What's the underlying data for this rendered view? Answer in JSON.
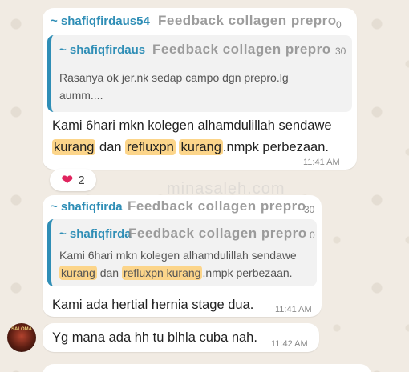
{
  "colors": {
    "accent": "#2f8eb6",
    "highlight": "#fcd58a",
    "heart": "#e0245e",
    "wallpaper": "#f1ebe3"
  },
  "overlay_title": "Feedback collagen prepro",
  "watermark": "minasaleh.com",
  "messages": [
    {
      "header_sender": "~ shafiqfirdaus54",
      "header_time_fragment": "0",
      "quote": {
        "sender": "~ shafiqfirdaus",
        "time_fragment": "30",
        "text_line1": "Rasanya ok jer.nk sedap campo dgn prepro.lg",
        "text_line2": "aumm...."
      },
      "body_line1": "Kami 6hari mkn kolegen alhamdulillah sendawe",
      "body_line2_hl1": "kurang",
      "body_line2_mid1": " dan ",
      "body_line2_hl2": "refluxpn",
      "body_line2_mid2": " ",
      "body_line2_hl3": "kurang",
      "body_line2_tail": ".nmpk perbezaan.",
      "time": "11:41 AM",
      "reaction": {
        "icon": "heart-icon",
        "emoji": "❤",
        "count": "2"
      }
    },
    {
      "header_sender": "~ shafiqfirda",
      "header_time_fragment": "30",
      "quote": {
        "sender": "~ shafiqfirda",
        "time_fragment": "0",
        "text_line1": "Kami 6hari mkn kolegen alhamdulillah sendawe",
        "text_line2_hl1": "kurang",
        "text_line2_mid": " dan ",
        "text_line2_hl2": "refluxpn kurang",
        "text_line2_tail": ".nmpk perbezaan."
      },
      "body": "Kami ada hertial hernia stage dua.",
      "time": "11:41 AM"
    },
    {
      "body": "Yg mana ada hh tu blhla cuba nah.",
      "time": "11:42 AM",
      "avatar_text": "SALOMA"
    }
  ]
}
